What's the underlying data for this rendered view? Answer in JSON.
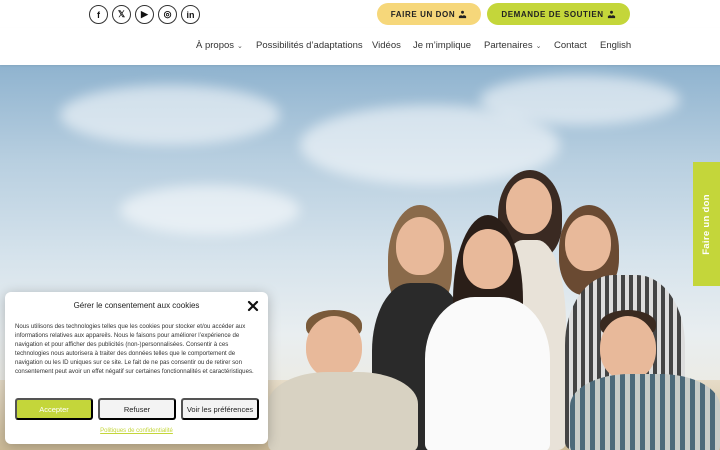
{
  "topbar": {
    "socials": [
      {
        "icon": "facebook-icon",
        "glyph": "f"
      },
      {
        "icon": "x-twitter-icon",
        "glyph": "𝕏"
      },
      {
        "icon": "youtube-icon",
        "glyph": "▶"
      },
      {
        "icon": "instagram-icon",
        "glyph": "◎"
      },
      {
        "icon": "linkedin-icon",
        "glyph": "in"
      }
    ],
    "donate_label": "FAIRE UN DON",
    "support_label": "DEMANDE DE SOUTIEN"
  },
  "nav": {
    "items": [
      {
        "label": "À propos",
        "dropdown": true
      },
      {
        "label": "Possibilités d’adaptations",
        "dropdown": false
      },
      {
        "label": "Vidéos",
        "dropdown": false
      },
      {
        "label": "Je m’implique",
        "dropdown": false
      },
      {
        "label": "Partenaires",
        "dropdown": true
      },
      {
        "label": "Contact",
        "dropdown": false
      },
      {
        "label": "English",
        "dropdown": false
      }
    ]
  },
  "side_tab": {
    "label": "Faire un don"
  },
  "cookie": {
    "title": "Gérer le consentement aux cookies",
    "text": "Nous utilisons des technologies telles que les cookies pour stocker et/ou accéder aux informations relatives aux appareils. Nous le faisons pour améliorer l’expérience de navigation et pour afficher des publicités (non-)personnalisées. Consentir à ces technologies nous autorisera à traiter des données telles que le comportement de navigation ou les ID uniques sur ce site. Le fait de ne pas consentir ou de retirer son consentement peut avoir un effet négatif sur certaines fonctionnalités et caractéristiques.",
    "accept_label": "Accepter",
    "refuse_label": "Refuser",
    "prefs_label": "Voir les préférences",
    "policy_label": "Politiques de confidentialité"
  },
  "colors": {
    "accent_green": "#c4d63a",
    "accent_yellow": "#f6d77a"
  }
}
